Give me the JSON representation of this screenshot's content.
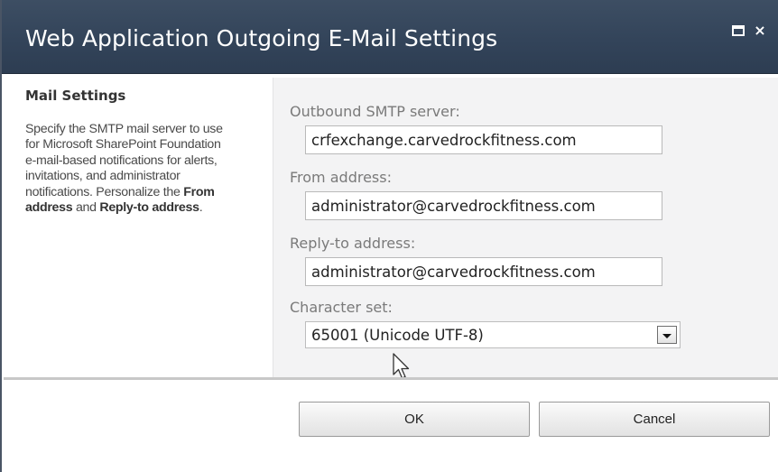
{
  "dialog": {
    "title": "Web Application Outgoing E-Mail Settings"
  },
  "window_controls": {
    "maximize_icon": "maximize-icon",
    "close_icon": "close-icon",
    "close_glyph": "×"
  },
  "section": {
    "title": "Mail Settings",
    "desc_pre": "Specify the SMTP mail server to use for Microsoft SharePoint Foundation e-mail-based notifications for alerts, invitations, and administrator notifications. Personalize the ",
    "desc_bold1": "From address",
    "desc_mid": " and ",
    "desc_bold2": "Reply-to address",
    "desc_post": "."
  },
  "fields": {
    "smtp": {
      "label": "Outbound SMTP server:",
      "value": "crfexchange.carvedrockfitness.com"
    },
    "from": {
      "label": "From address:",
      "value": "administrator@carvedrockfitness.com"
    },
    "reply": {
      "label": "Reply-to address:",
      "value": "administrator@carvedrockfitness.com"
    },
    "charset": {
      "label": "Character set:",
      "value": "65001 (Unicode UTF-8)"
    }
  },
  "buttons": {
    "ok": "OK",
    "cancel": "Cancel"
  },
  "colors": {
    "titlebar": "#33445a",
    "panel": "#f3f3f4",
    "label": "#7a7a7a"
  }
}
